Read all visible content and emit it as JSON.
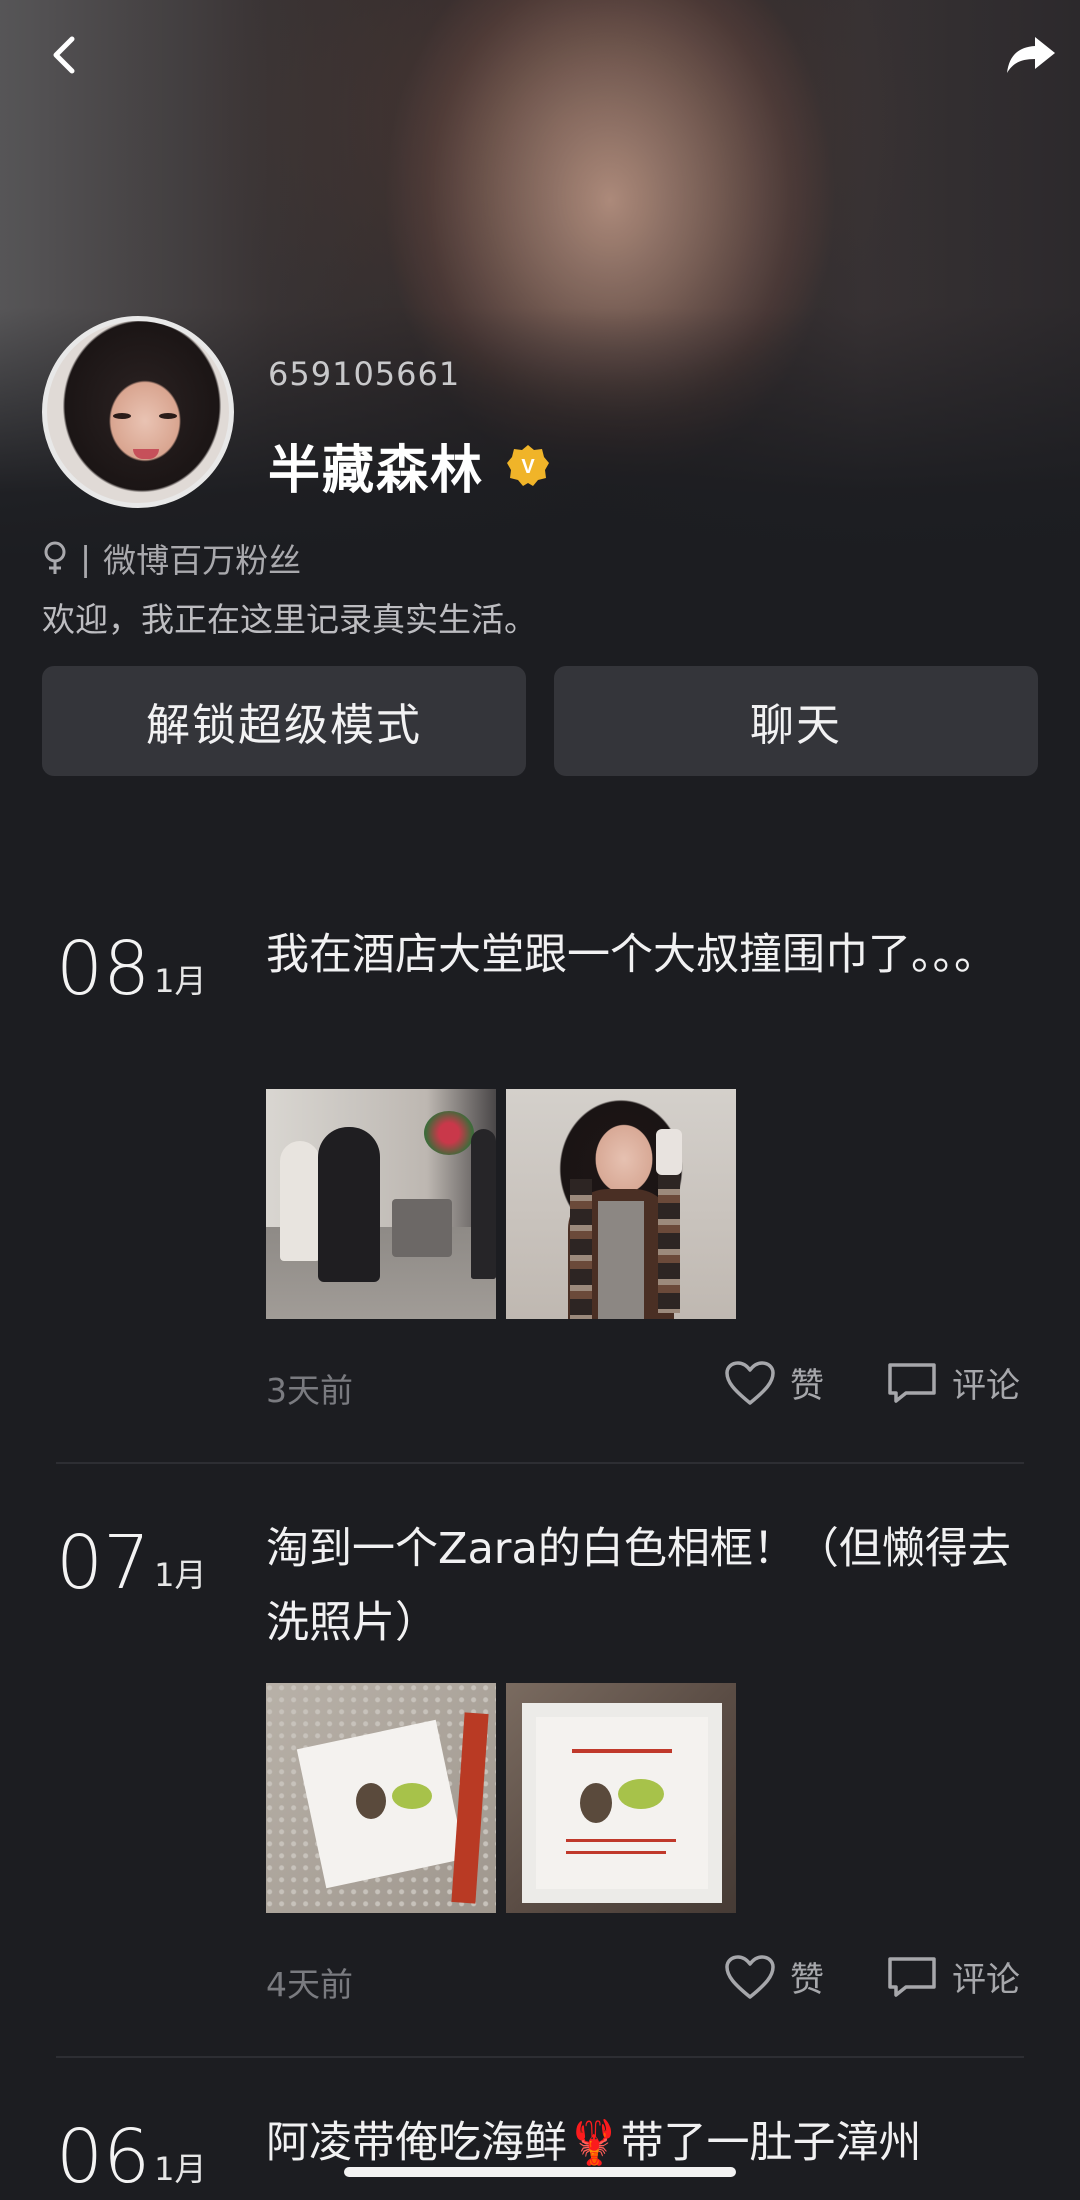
{
  "header": {
    "uid": "659105661",
    "name": "半藏森林",
    "badge": "V"
  },
  "profile": {
    "gender_icon": "female-icon",
    "separator": "|",
    "tag": "微博百万粉丝",
    "bio": "欢迎，我正在这里记录真实生活。"
  },
  "buttons": {
    "unlock": "解锁超级模式",
    "chat": "聊天"
  },
  "posts": [
    {
      "day": "08",
      "month": "1月",
      "text": "我在酒店大堂跟一个大叔撞围巾了。。。",
      "time": "3天前",
      "like": "赞",
      "comment": "评论"
    },
    {
      "day": "07",
      "month": "1月",
      "text": "淘到一个Zara的白色相框！（但懒得去洗照片）",
      "time": "4天前",
      "like": "赞",
      "comment": "评论"
    },
    {
      "day": "06",
      "month": "1月",
      "text": "阿凌带俺吃海鲜🦞带了一肚子漳州"
    }
  ],
  "colors": {
    "background": "#1c1d21",
    "button": "#34353a",
    "badge": "#f0b429"
  }
}
